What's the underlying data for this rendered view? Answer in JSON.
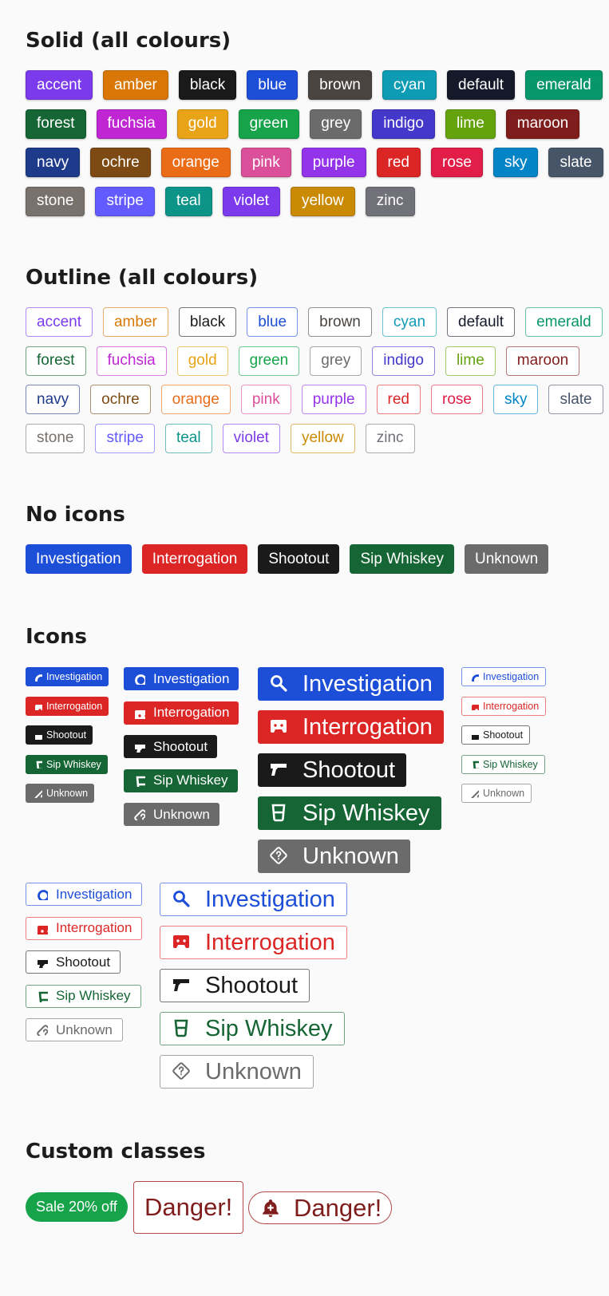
{
  "sections": {
    "solid": "Solid (all colours)",
    "outline": "Outline (all colours)",
    "no_icons": "No icons",
    "icons": "Icons",
    "custom": "Custom classes"
  },
  "colour_rows": [
    [
      {
        "name": "accent",
        "color": "#7c3aed"
      },
      {
        "name": "amber",
        "color": "#d97706"
      },
      {
        "name": "black",
        "color": "#1a1a1a"
      },
      {
        "name": "blue",
        "color": "#1d4ed8"
      },
      {
        "name": "brown",
        "color": "#4a4440"
      },
      {
        "name": "cyan",
        "color": "#0e9bb4"
      },
      {
        "name": "default",
        "color": "#15192a"
      },
      {
        "name": "emerald",
        "color": "#059669"
      }
    ],
    [
      {
        "name": "forest",
        "color": "#166534"
      },
      {
        "name": "fuchsia",
        "color": "#c026d3"
      },
      {
        "name": "gold",
        "color": "#e8a317"
      },
      {
        "name": "green",
        "color": "#16a34a"
      },
      {
        "name": "grey",
        "color": "#6b6b6b"
      },
      {
        "name": "indigo",
        "color": "#4338ca"
      },
      {
        "name": "lime",
        "color": "#65a30d"
      },
      {
        "name": "maroon",
        "color": "#7f1d1d"
      }
    ],
    [
      {
        "name": "navy",
        "color": "#1e3a8a"
      },
      {
        "name": "ochre",
        "color": "#7c4a12"
      },
      {
        "name": "orange",
        "color": "#ea6c17"
      },
      {
        "name": "pink",
        "color": "#db4f9a"
      },
      {
        "name": "purple",
        "color": "#9333ea"
      },
      {
        "name": "red",
        "color": "#dc2626"
      },
      {
        "name": "rose",
        "color": "#e11d48"
      },
      {
        "name": "sky",
        "color": "#0284c7"
      },
      {
        "name": "slate",
        "color": "#475569"
      }
    ],
    [
      {
        "name": "stone",
        "color": "#78716c"
      },
      {
        "name": "stripe",
        "color": "#635bff"
      },
      {
        "name": "teal",
        "color": "#0d9488"
      },
      {
        "name": "violet",
        "color": "#7c3aed"
      },
      {
        "name": "yellow",
        "color": "#ca8a04"
      },
      {
        "name": "zinc",
        "color": "#71717a"
      }
    ]
  ],
  "topics": [
    {
      "label": "Investigation",
      "icon": "search-icon",
      "color": "#1d4ed8"
    },
    {
      "label": "Interrogation",
      "icon": "cassette-icon",
      "color": "#dc2626"
    },
    {
      "label": "Shootout",
      "icon": "pistol-icon",
      "color": "#1a1a1a"
    },
    {
      "label": "Sip Whiskey",
      "icon": "whiskey-glass-icon",
      "color": "#166534"
    },
    {
      "label": "Unknown",
      "icon": "question-diamond-icon",
      "color": "#6b6b6b"
    }
  ],
  "custom": {
    "sale": "Sale 20% off",
    "sale_color": "#16a34a",
    "danger": "Danger!",
    "danger_color": "#7f1d1d",
    "danger_icon": "bell-icon"
  }
}
